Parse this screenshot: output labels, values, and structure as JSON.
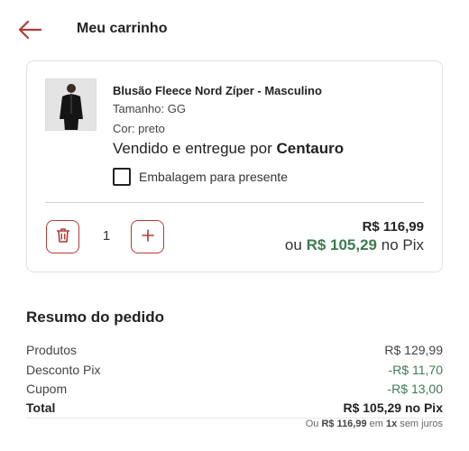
{
  "header": {
    "title": "Meu carrinho"
  },
  "item": {
    "name": "Blusão Fleece Nord Zíper - Masculino",
    "size": "Tamanho: GG",
    "color": "Cor: preto",
    "seller_prefix": "Vendido e entregue por",
    "seller_name": "Centauro",
    "gift_label": "Embalagem para presente",
    "gift_checked": false,
    "quantity": "1",
    "price": "R$ 116,99",
    "pix_prefix": "ou",
    "pix_price": "R$ 105,29",
    "pix_suffix": "no Pix"
  },
  "summary": {
    "title": "Resumo do pedido",
    "rows": [
      {
        "label": "Produtos",
        "value": "R$ 129,99"
      },
      {
        "label": "Desconto Pix",
        "value": "-R$ 11,70"
      },
      {
        "label": "Cupom",
        "value": "-R$ 13,00"
      }
    ],
    "total_label": "Total",
    "total_value": "R$ 105,29 no Pix",
    "installments": {
      "prefix": "Ou",
      "amount": "R$ 116,99",
      "middle": "em",
      "count": "1x",
      "suffix": "sem juros"
    }
  },
  "colors": {
    "accent": "#b43a35",
    "discount_green": "#3d7b4f"
  },
  "icons": [
    "back-arrow-icon",
    "trash-icon",
    "plus-icon"
  ]
}
